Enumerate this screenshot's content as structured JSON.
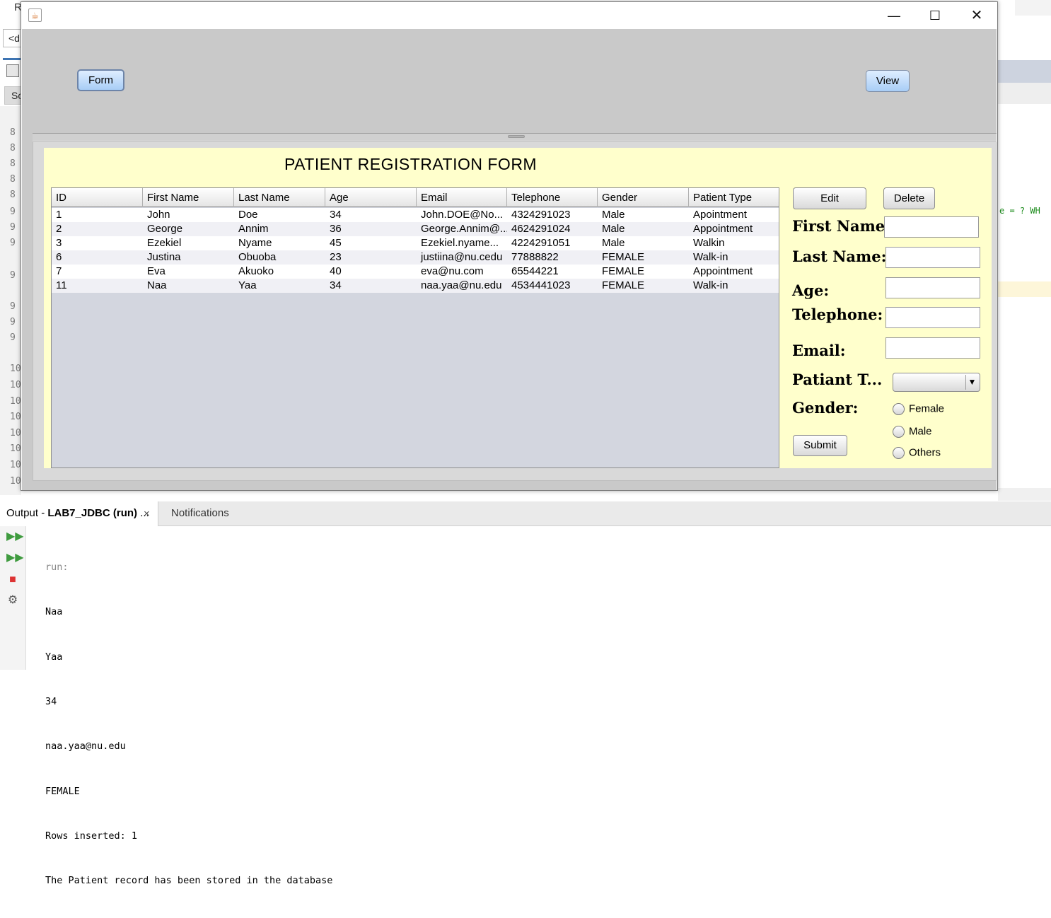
{
  "ide": {
    "title_fragment": "R",
    "combo_text": "<d",
    "source_tab": "So",
    "code_fragment": "e = ? WH",
    "line_numbers": [
      "8",
      "8",
      "8",
      "8",
      "8",
      "9",
      "9",
      "9",
      "9",
      "9",
      "9",
      "9",
      "10",
      "10",
      "10",
      "10",
      "10",
      "10",
      "10",
      "10"
    ]
  },
  "frame": {
    "window_controls": {
      "minimize": "—",
      "maximize": "☐",
      "close": "✕"
    },
    "top_buttons": {
      "form": "Form",
      "view": "View"
    },
    "form_title": "PATIENT REGISTRATION FORM",
    "table": {
      "columns": [
        "ID",
        "First Name",
        "Last Name",
        "Age",
        "Email",
        "Telephone",
        "Gender",
        "Patient Type"
      ],
      "rows": [
        [
          "1",
          "John",
          "Doe",
          "34",
          "John.DOE@No...",
          "4324291023",
          "Male",
          "Apointment"
        ],
        [
          "2",
          "George",
          "Annim",
          "36",
          "George.Annim@...",
          "4624291024",
          "Male",
          "Appointment"
        ],
        [
          "3",
          "Ezekiel",
          "Nyame",
          "45",
          "Ezekiel.nyame...",
          "4224291051",
          "Male",
          "Walkin"
        ],
        [
          "6",
          "Justina",
          "Obuoba",
          "23",
          "justiina@nu.cedu",
          "77888822",
          "FEMALE",
          "Walk-in"
        ],
        [
          "7",
          "Eva",
          "Akuoko",
          "40",
          "eva@nu.com",
          "65544221",
          "FEMALE",
          "Appointment"
        ],
        [
          "11",
          "Naa",
          "Yaa",
          "34",
          "naa.yaa@nu.edu",
          "4534441023",
          "FEMALE",
          "Walk-in"
        ]
      ]
    },
    "buttons": {
      "edit": "Edit",
      "delete": "Delete",
      "submit": "Submit"
    },
    "labels": {
      "first_name": "First Name:",
      "last_name": "Last Name:",
      "age": "Age:",
      "telephone": "Telephone:",
      "email": "Email:",
      "patient_type": "Patiant T...",
      "gender": "Gender:"
    },
    "inputs": {
      "first_name": "",
      "last_name": "",
      "age": "",
      "telephone": "",
      "email": ""
    },
    "patient_type_selected": "",
    "gender_options": [
      "Female",
      "Male",
      "Others"
    ]
  },
  "output": {
    "tab_prefix": "Output - ",
    "tab_title": "LAB7_JDBC (run)",
    "tab_ellipsis": " ...",
    "tab_close": "×",
    "notifications_tab": "Notifications",
    "lines": [
      "run:",
      "Naa",
      "Yaa",
      "34",
      "naa.yaa@nu.edu",
      "FEMALE",
      "Rows inserted: 1",
      "The Patient record has been stored in the database"
    ]
  }
}
